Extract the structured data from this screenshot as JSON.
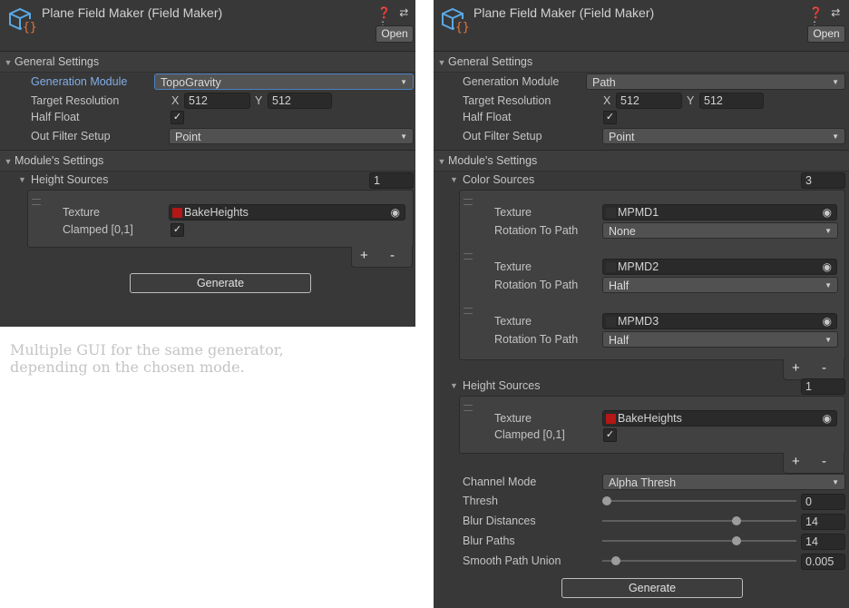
{
  "window_icons": "❓ ⇄ ⋮",
  "left": {
    "title": "Plane Field Maker (Field Maker)",
    "open_label": "Open",
    "general_settings": "General Settings",
    "generation_module_label": "Generation Module",
    "generation_module_value": "TopoGravity",
    "target_resolution_label": "Target Resolution",
    "x_label": "X",
    "x_value": "512",
    "y_label": "Y",
    "y_value": "512",
    "half_float_label": "Half Float",
    "out_filter_label": "Out Filter Setup",
    "out_filter_value": "Point",
    "module_settings": "Module's Settings",
    "height_sources_label": "Height Sources",
    "height_sources_count": "1",
    "texture_label": "Texture",
    "texture_value": "BakeHeights",
    "clamped_label": "Clamped [0,1]",
    "add_remove": "+ -",
    "generate_label": "Generate"
  },
  "caption": {
    "line1": "Multiple GUI for the same generator,",
    "line2": "depending on the chosen mode."
  },
  "right": {
    "title": "Plane Field Maker (Field Maker)",
    "open_label": "Open",
    "general_settings": "General Settings",
    "generation_module_label": "Generation Module",
    "generation_module_value": "Path",
    "target_resolution_label": "Target Resolution",
    "x_label": "X",
    "x_value": "512",
    "y_label": "Y",
    "y_value": "512",
    "half_float_label": "Half Float",
    "out_filter_label": "Out Filter Setup",
    "out_filter_value": "Point",
    "module_settings": "Module's Settings",
    "color_sources_label": "Color Sources",
    "color_sources_count": "3",
    "color_items": [
      {
        "texture_label": "Texture",
        "texture_value": "MPMD1",
        "rotation_label": "Rotation To Path",
        "rotation_value": "None"
      },
      {
        "texture_label": "Texture",
        "texture_value": "MPMD2",
        "rotation_label": "Rotation To Path",
        "rotation_value": "Half"
      },
      {
        "texture_label": "Texture",
        "texture_value": "MPMD3",
        "rotation_label": "Rotation To Path",
        "rotation_value": "Half"
      }
    ],
    "height_sources_label": "Height Sources",
    "height_sources_count": "1",
    "texture_label": "Texture",
    "texture_value": "BakeHeights",
    "clamped_label": "Clamped [0,1]",
    "add_remove": "+ -",
    "channel_mode_label": "Channel Mode",
    "channel_mode_value": "Alpha Thresh",
    "thresh_label": "Thresh",
    "thresh_value": "0",
    "thresh_fraction": 0.0,
    "blur_distances_label": "Blur Distances",
    "blur_distances_value": "14",
    "blur_distances_fraction": 0.7,
    "blur_paths_label": "Blur Paths",
    "blur_paths_value": "14",
    "blur_paths_fraction": 0.7,
    "smooth_union_label": "Smooth Path Union",
    "smooth_union_value": "0.005",
    "smooth_union_fraction": 0.05,
    "generate_label": "Generate"
  },
  "colors": {
    "panel_bg": "#383838",
    "focus_border": "#4a82c4",
    "label_highlight": "#82aee8",
    "texture_swatch": "#b51616",
    "script_icon_blue": "#5aa9e6",
    "script_icon_orange": "#e8743b"
  }
}
